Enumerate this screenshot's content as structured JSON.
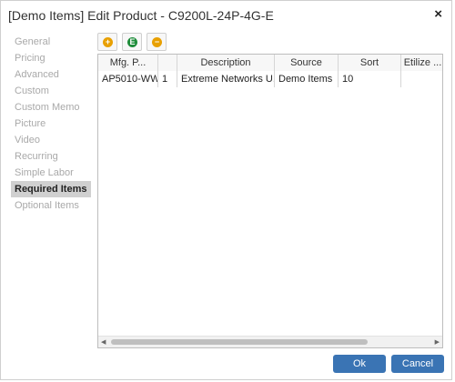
{
  "dialog": {
    "title": "[Demo Items] Edit Product - C9200L-24P-4G-E",
    "close_label": "×"
  },
  "sidebar": {
    "items": [
      {
        "label": "General"
      },
      {
        "label": "Pricing"
      },
      {
        "label": "Advanced"
      },
      {
        "label": "Custom"
      },
      {
        "label": "Custom Memo"
      },
      {
        "label": "Picture"
      },
      {
        "label": "Video"
      },
      {
        "label": "Recurring"
      },
      {
        "label": "Simple Labor"
      },
      {
        "label": "Required Items",
        "active": true
      },
      {
        "label": "Optional Items"
      }
    ]
  },
  "toolbar": {
    "add_glyph": "+",
    "edit_glyph": "E",
    "remove_glyph": "−",
    "add_color": "#e8a000",
    "edit_color": "#1e8c3a",
    "remove_color": "#e8a000"
  },
  "grid": {
    "headers": [
      "Mfg. P...",
      "",
      "Description",
      "Source",
      "Sort",
      "Etilize ..."
    ],
    "rows": [
      [
        "AP5010-WW",
        "1",
        "Extreme Networks U...",
        "Demo Items",
        "10",
        ""
      ]
    ]
  },
  "scrollbar": {
    "left_arrow": "◀",
    "right_arrow": "▶"
  },
  "buttons": {
    "ok_label": "Ok",
    "cancel_label": "Cancel"
  },
  "colors": {
    "accent": "#3a74b4"
  }
}
